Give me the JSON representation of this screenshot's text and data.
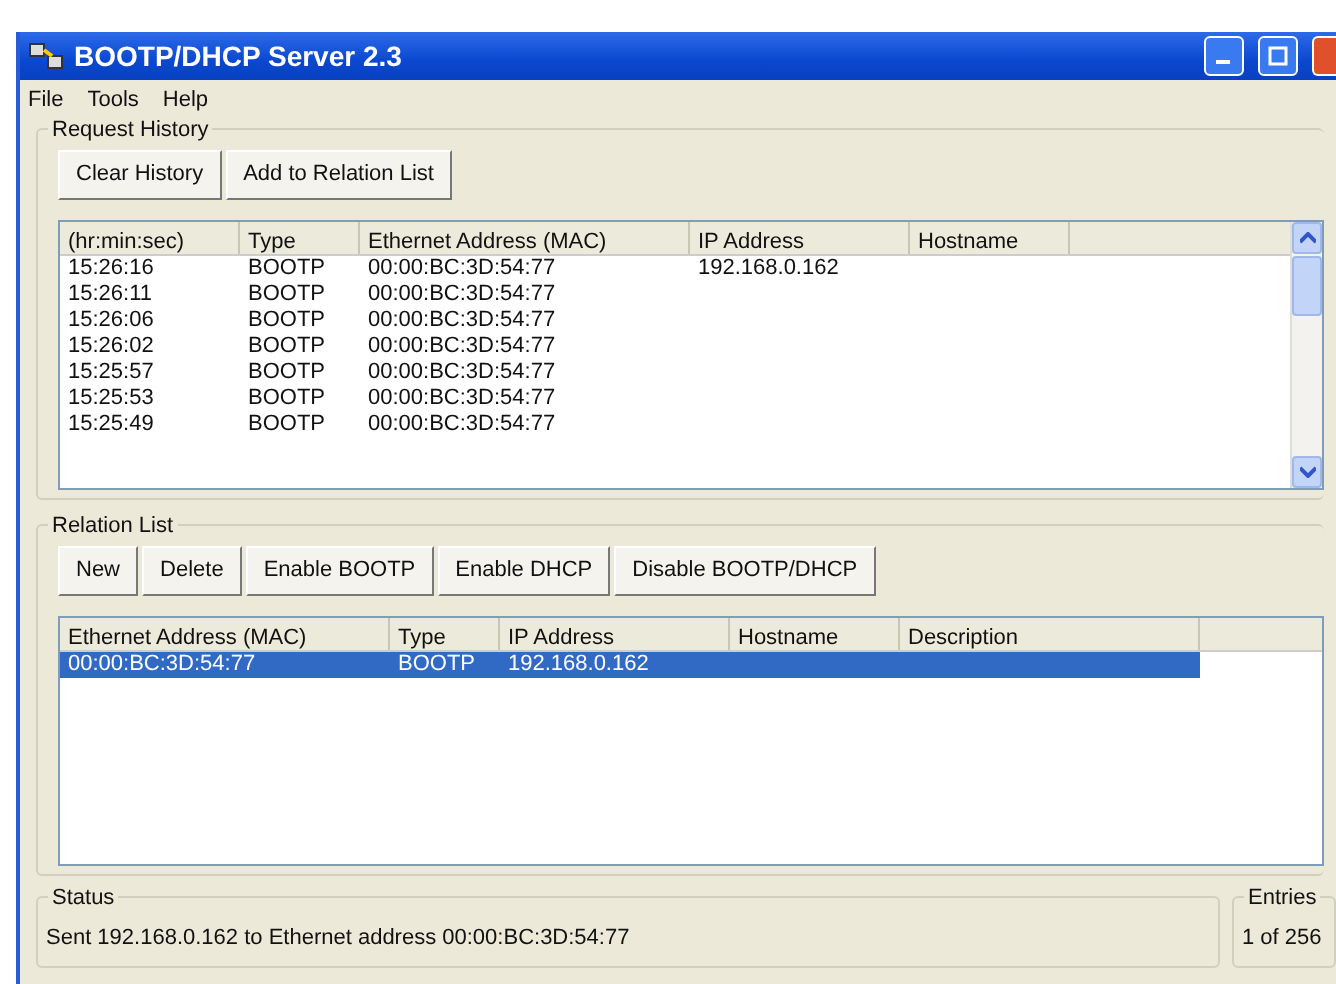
{
  "window": {
    "title": "BOOTP/DHCP Server 2.3"
  },
  "menu": [
    "File",
    "Tools",
    "Help"
  ],
  "request_history": {
    "title": "Request History",
    "buttons": [
      "Clear History",
      "Add to Relation List"
    ],
    "columns": [
      "(hr:min:sec)",
      "Type",
      "Ethernet Address (MAC)",
      "IP Address",
      "Hostname"
    ],
    "rows": [
      {
        "cells": [
          "15:26:16",
          "BOOTP",
          "00:00:BC:3D:54:77",
          "192.168.0.162",
          ""
        ]
      },
      {
        "cells": [
          "15:26:11",
          "BOOTP",
          "00:00:BC:3D:54:77",
          "",
          ""
        ]
      },
      {
        "cells": [
          "15:26:06",
          "BOOTP",
          "00:00:BC:3D:54:77",
          "",
          ""
        ]
      },
      {
        "cells": [
          "15:26:02",
          "BOOTP",
          "00:00:BC:3D:54:77",
          "",
          ""
        ]
      },
      {
        "cells": [
          "15:25:57",
          "BOOTP",
          "00:00:BC:3D:54:77",
          "",
          ""
        ]
      },
      {
        "cells": [
          "15:25:53",
          "BOOTP",
          "00:00:BC:3D:54:77",
          "",
          ""
        ]
      },
      {
        "cells": [
          "15:25:49",
          "BOOTP",
          "00:00:BC:3D:54:77",
          "",
          ""
        ]
      }
    ]
  },
  "relation_list": {
    "title": "Relation List",
    "buttons": [
      "New",
      "Delete",
      "Enable BOOTP",
      "Enable DHCP",
      "Disable BOOTP/DHCP"
    ],
    "columns": [
      "Ethernet Address (MAC)",
      "Type",
      "IP Address",
      "Hostname",
      "Description"
    ],
    "rows": [
      {
        "cells": [
          "00:00:BC:3D:54:77",
          "BOOTP",
          "192.168.0.162",
          "",
          ""
        ],
        "selected": true
      }
    ]
  },
  "status_bar": {
    "status_title": "Status",
    "status": "Sent 192.168.0.162 to Ethernet address 00:00:BC:3D:54:77",
    "entries_title": "Entries",
    "entries": "1 of 256"
  }
}
